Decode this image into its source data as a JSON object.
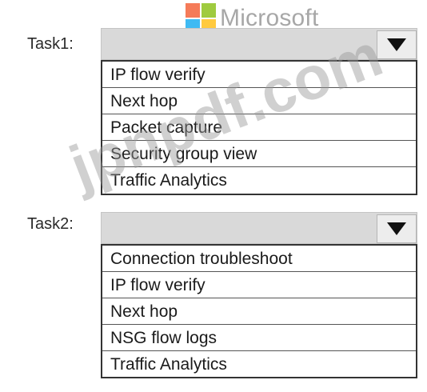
{
  "logo": {
    "text": "Microsoft"
  },
  "task1": {
    "label": "Task1:",
    "options": [
      "IP flow verify",
      "Next hop",
      "Packet capture",
      "Security group view",
      "Traffic Analytics"
    ]
  },
  "task2": {
    "label": "Task2:",
    "options": [
      "Connection troubleshoot",
      "IP flow verify",
      "Next hop",
      "NSG flow logs",
      "Traffic Analytics"
    ]
  },
  "watermark": {
    "text": "jpnpdf.com"
  }
}
